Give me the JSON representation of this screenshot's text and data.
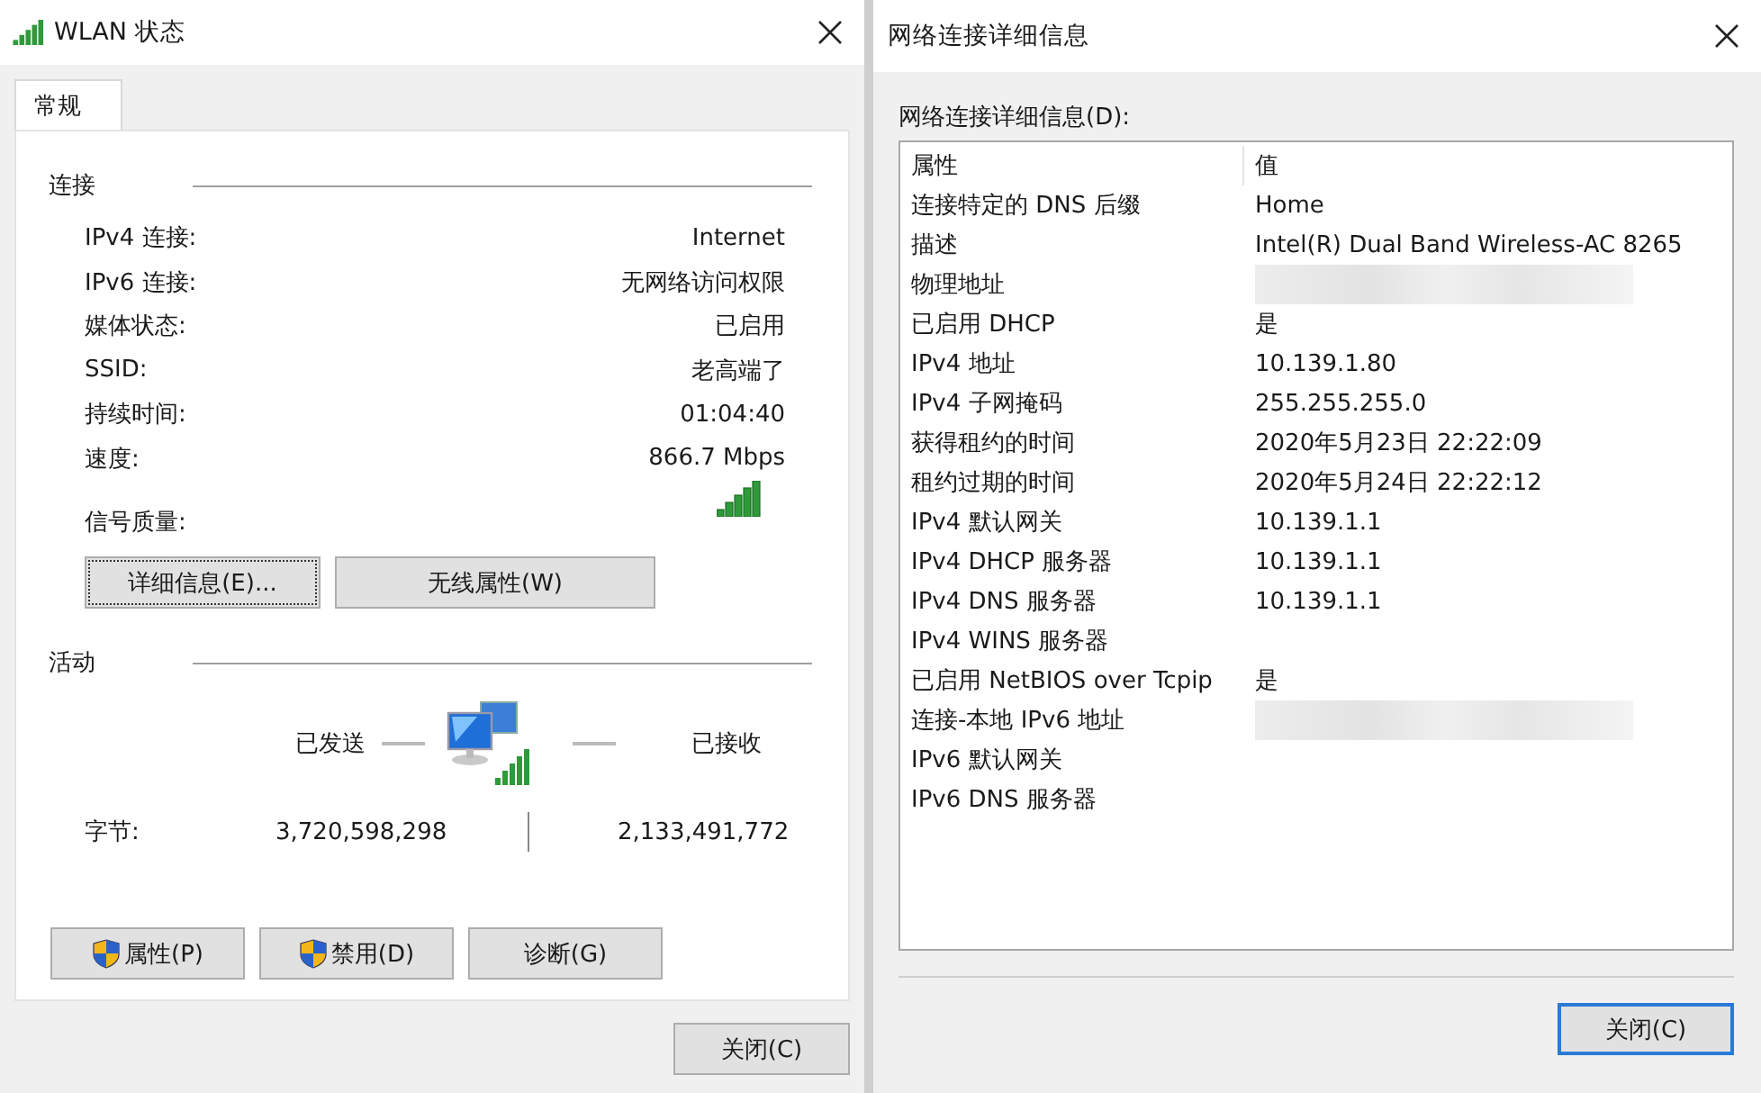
{
  "left_window": {
    "title": "WLAN 状态",
    "tabs": [
      {
        "label": "常规",
        "selected": true
      }
    ],
    "connection": {
      "heading": "连接",
      "fields": [
        {
          "label": "IPv4 连接:",
          "value": "Internet"
        },
        {
          "label": "IPv6 连接:",
          "value": "无网络访问权限"
        },
        {
          "label": "媒体状态:",
          "value": "已启用"
        },
        {
          "label": "SSID:",
          "value": "老高端了"
        },
        {
          "label": "持续时间:",
          "value": "01:04:40"
        },
        {
          "label": "速度:",
          "value": "866.7 Mbps"
        }
      ],
      "signal_label": "信号质量:",
      "buttons": [
        {
          "label": "详细信息(E)...",
          "focused": true
        },
        {
          "label": "无线属性(W)",
          "focused": false
        }
      ]
    },
    "activity": {
      "heading": "活动",
      "sent_label": "已发送",
      "received_label": "已接收",
      "bytes_label": "字节:",
      "bytes_sent": "3,720,598,298",
      "bytes_received": "2,133,491,772"
    },
    "action_buttons": [
      {
        "label": "属性(P)",
        "shield": true
      },
      {
        "label": "禁用(D)",
        "shield": true
      },
      {
        "label": "诊断(G)",
        "shield": false
      }
    ],
    "close_button": {
      "label": "关闭(C)",
      "default": false
    }
  },
  "right_window": {
    "title": "网络连接详细信息",
    "list_label": "网络连接详细信息(D):",
    "columns": [
      "属性",
      "值"
    ],
    "rows": [
      {
        "property": "连接特定的 DNS 后缀",
        "value": "Home"
      },
      {
        "property": "描述",
        "value": "Intel(R) Dual Band Wireless-AC 8265"
      },
      {
        "property": "物理地址",
        "redacted": true
      },
      {
        "property": "已启用 DHCP",
        "value": "是"
      },
      {
        "property": "IPv4 地址",
        "value": "10.139.1.80"
      },
      {
        "property": "IPv4 子网掩码",
        "value": "255.255.255.0"
      },
      {
        "property": "获得租约的时间",
        "value": "2020年5月23日 22:22:09"
      },
      {
        "property": "租约过期的时间",
        "value": "2020年5月24日 22:22:12"
      },
      {
        "property": "IPv4 默认网关",
        "value": "10.139.1.1"
      },
      {
        "property": "IPv4 DHCP 服务器",
        "value": "10.139.1.1"
      },
      {
        "property": "IPv4 DNS 服务器",
        "value": "10.139.1.1"
      },
      {
        "property": "IPv4 WINS 服务器"
      },
      {
        "property": "已启用 NetBIOS over Tcpip",
        "value": "是"
      },
      {
        "property": "连接-本地 IPv6 地址",
        "redacted": true
      },
      {
        "property": "IPv6 默认网关"
      },
      {
        "property": "IPv6 DNS 服务器"
      }
    ],
    "close_button": {
      "label": "关闭(C)",
      "default": true
    }
  }
}
